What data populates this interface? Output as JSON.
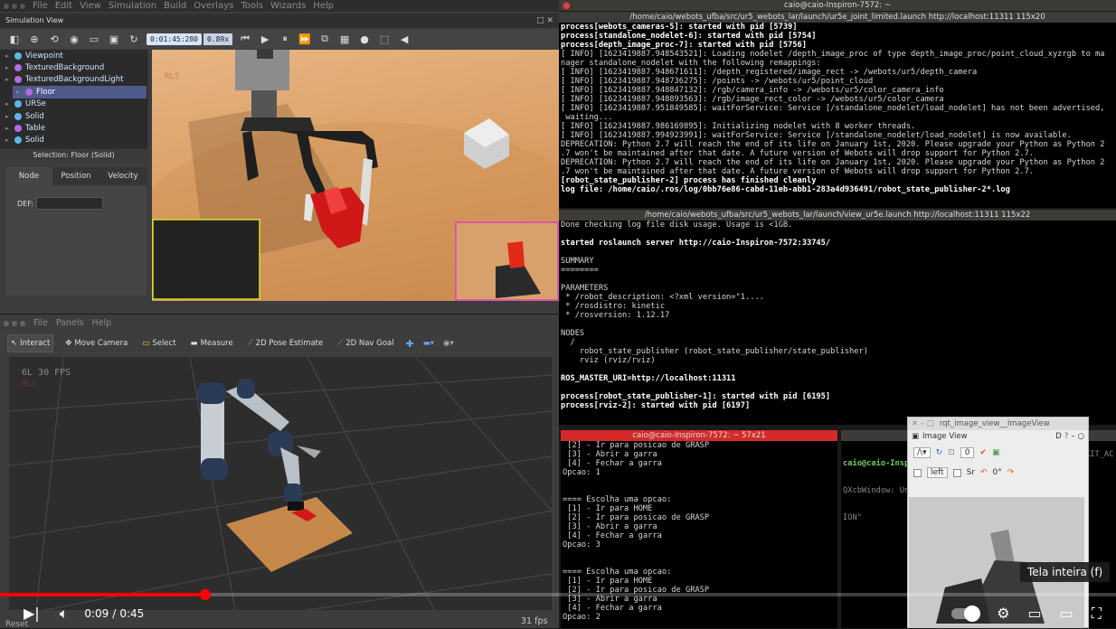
{
  "webots": {
    "menu": [
      "File",
      "Edit",
      "View",
      "Simulation",
      "Build",
      "Overlays",
      "Tools",
      "Wizards",
      "Help"
    ],
    "panel_title": "Simulation View",
    "time": "0:01:45:280",
    "speed": "0.89x",
    "tree_items": [
      {
        "label": "Viewpoint",
        "color": "#5bb8e8"
      },
      {
        "label": "TexturedBackground",
        "color": "#b26be0"
      },
      {
        "label": "TexturedBackgroundLight",
        "color": "#b26be0"
      },
      {
        "label": "Floor",
        "color": "#b26be0"
      },
      {
        "label": "URSe",
        "color": "#5bb8e8"
      },
      {
        "label": "Solid",
        "color": "#5bb8e8"
      },
      {
        "label": "Table",
        "color": "#b26be0"
      },
      {
        "label": "Solid",
        "color": "#5bb8e8"
      }
    ],
    "selection": "Selection: Floor (Solid)",
    "field_tabs": [
      "Node",
      "Position",
      "Velocity"
    ],
    "def_label": "DEF:"
  },
  "rviz": {
    "menu": [
      "File",
      "Panels",
      "Help"
    ],
    "tools": [
      "Interact",
      "Move Camera",
      "Select",
      "Measure",
      "2D Pose Estimate",
      "2D Nav Goal"
    ],
    "fps_overlay": "6L 30 FPS",
    "corner_fps": "31 fps"
  },
  "term1": {
    "header": "caio@caio-Inspiron-7572: ~",
    "title": "/home/caio/webots_ufba/src/ur5_webots_lar/launch/ur5e_joint_limited.launch http://localhost:11311 115x20",
    "lines": [
      {
        "t": "process[webots_cameras-5]: started with pid [5739]",
        "b": true
      },
      {
        "t": "process[standalone_nodelet-6]: started with pid [5754]",
        "b": true
      },
      {
        "t": "process[depth_image_proc-7]: started with pid [5756]",
        "b": true
      },
      {
        "t": "[ INFO] [1623419887.948543521]: Loading nodelet /depth_image_proc of type depth_image_proc/point_cloud_xyzrgb to ma",
        "b": false
      },
      {
        "t": "nager standalone_nodelet with the following remappings:",
        "b": false
      },
      {
        "t": "[ INFO] [1623419887.948671611]: /depth_registered/image_rect -> /webots/ur5/depth_camera",
        "b": false
      },
      {
        "t": "[ INFO] [1623419887.948736275]: /points -> /webots/ur5/point_cloud",
        "b": false
      },
      {
        "t": "[ INFO] [1623419887.948847132]: /rgb/camera_info -> /webots/ur5/color_camera_info",
        "b": false
      },
      {
        "t": "[ INFO] [1623419887.948893563]: /rgb/image_rect_color -> /webots/ur5/color_camera",
        "b": false
      },
      {
        "t": "[ INFO] [1623419887.951849585]: waitForService: Service [/standalone_nodelet/load_nodelet] has not been advertised,",
        "b": false
      },
      {
        "t": " waiting...",
        "b": false
      },
      {
        "t": "[ INFO] [1623419887.986169895]: Initializing nodelet with 8 worker threads.",
        "b": false
      },
      {
        "t": "[ INFO] [1623419887.994923991]: waitForService: Service [/standalone_nodelet/load_nodelet] is now available.",
        "b": false
      },
      {
        "t": "DEPRECATION: Python 2.7 will reach the end of its life on January 1st, 2020. Please upgrade your Python as Python 2",
        "b": false
      },
      {
        "t": ".7 won't be maintained after that date. A future version of Webots will drop support for Python 2.7.",
        "b": false
      },
      {
        "t": "DEPRECATION: Python 2.7 will reach the end of its life on January 1st, 2020. Please upgrade your Python as Python 2",
        "b": false
      },
      {
        "t": ".7 won't be maintained after that date. A future version of Webots will drop support for Python 2.7.",
        "b": false
      },
      {
        "t": "[robot_state_publisher-2] process has finished cleanly",
        "b": true
      },
      {
        "t": "log file: /home/caio/.ros/log/0bb76e86-cabd-11eb-abb1-283a4d936491/robot_state_publisher-2*.log",
        "b": true
      }
    ]
  },
  "term2": {
    "title": "/home/caio/webots_ufba/src/ur5_webots_lar/launch/view_ur5e.launch http://localhost:11311 115x22",
    "lines": [
      {
        "t": "Done checking log file disk usage. Usage is <1GB.",
        "b": false
      },
      {
        "t": "",
        "b": false
      },
      {
        "t": "started roslaunch server http://caio-Inspiron-7572:33745/",
        "b": true
      },
      {
        "t": "",
        "b": false
      },
      {
        "t": "SUMMARY",
        "b": false
      },
      {
        "t": "========",
        "b": false
      },
      {
        "t": "",
        "b": false
      },
      {
        "t": "PARAMETERS",
        "b": false
      },
      {
        "t": " * /robot_description: <?xml version=\"1....",
        "b": false
      },
      {
        "t": " * /rosdistro: kinetic",
        "b": false
      },
      {
        "t": " * /rosversion: 1.12.17",
        "b": false
      },
      {
        "t": "",
        "b": false
      },
      {
        "t": "NODES",
        "b": false
      },
      {
        "t": "  /",
        "b": false
      },
      {
        "t": "    robot_state_publisher (robot_state_publisher/state_publisher)",
        "b": false
      },
      {
        "t": "    rviz (rviz/rviz)",
        "b": false
      },
      {
        "t": "",
        "b": false
      },
      {
        "t": "ROS_MASTER_URI=http://localhost:11311",
        "b": true
      },
      {
        "t": "",
        "b": false
      },
      {
        "t": "process[robot_state_publisher-1]: started with pid [6195]",
        "b": true
      },
      {
        "t": "process[rviz-2]: started with pid [6197]",
        "b": true
      }
    ]
  },
  "term3": {
    "title": "caio@caio-Inspiron-7572: ~ 57x21",
    "lines": [
      " [2] - Ir para posicao de GRASP",
      " [3] - Abrir a garra",
      " [4] - Fechar a garra",
      "Opcao: 1",
      "",
      "",
      "==== Escolha uma opcao:",
      " [1] - Ir para HOME",
      " [2] - Ir para posicao de GRASP",
      " [3] - Abrir a garra",
      " [4] - Fechar a garra",
      "Opcao: 3",
      "",
      "",
      "==== Escolha uma opcao:",
      " [1] - Ir para HOME",
      " [2] - Ir para posicao de GRASP",
      " [3] - Abrir a garra",
      " [4] - Fechar a garra",
      "Opcao: 2"
    ]
  },
  "term4": {
    "prompt": "caio@caio-Insp",
    "lines": [
      "QXcbWindow: Un",
      "ION\""
    ],
    "side": "KIT_AC"
  },
  "imgview": {
    "window_title": "rqt_image_view__ImageView",
    "plugin_title": "Image View",
    "plugin_right": "D",
    "spin_value": "0",
    "left_label": "left",
    "sr_label": "Sr",
    "angle": "0°"
  },
  "youtube": {
    "current_time": "0:09",
    "separator": "/",
    "duration": "0:45",
    "progress": 0.184,
    "tooltip": "Tela inteira (f)",
    "reset_label": "Reset"
  }
}
